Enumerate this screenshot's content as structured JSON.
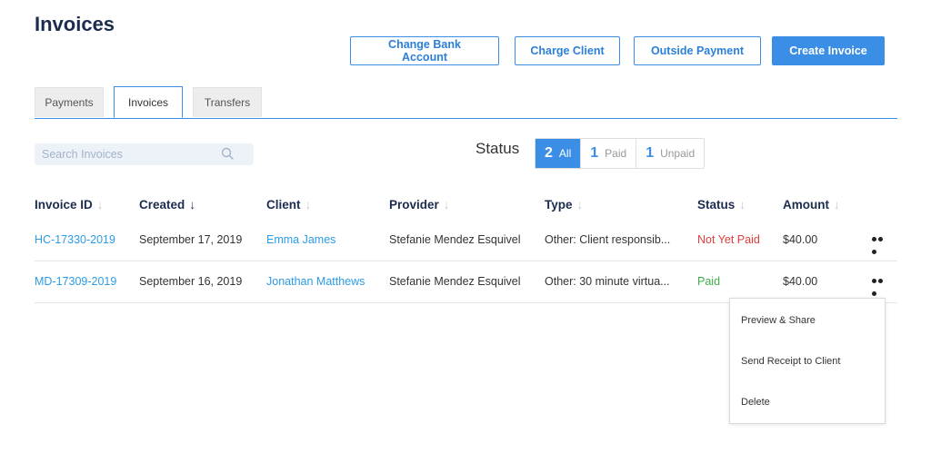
{
  "page": {
    "title": "Invoices"
  },
  "actions": {
    "change_bank": "Change Bank Account",
    "charge_client": "Charge Client",
    "outside_payment": "Outside Payment",
    "create_invoice": "Create Invoice"
  },
  "tabs": [
    {
      "label": "Payments",
      "active": false
    },
    {
      "label": "Invoices",
      "active": true
    },
    {
      "label": "Transfers",
      "active": false
    }
  ],
  "search": {
    "placeholder": "Search Invoices",
    "value": ""
  },
  "status_filter": {
    "label": "Status",
    "options": [
      {
        "count": "2",
        "label": "All",
        "active": true
      },
      {
        "count": "1",
        "label": "Paid",
        "active": false
      },
      {
        "count": "1",
        "label": "Unpaid",
        "active": false
      }
    ]
  },
  "table": {
    "columns": [
      "Invoice ID",
      "Created",
      "Client",
      "Provider",
      "Type",
      "Status",
      "Amount"
    ],
    "sort_arrow": "↓",
    "rows": [
      {
        "invoice_id": "HC-17330-2019",
        "created": "September 17, 2019",
        "client": "Emma James",
        "provider": "Stefanie Mendez Esquivel",
        "type": "Other: Client responsib...",
        "status": "Not Yet Paid",
        "amount": "$40.00"
      },
      {
        "invoice_id": "MD-17309-2019",
        "created": "September 16, 2019",
        "client": "Jonathan Matthews",
        "provider": "Stefanie Mendez Esquivel",
        "type": "Other: 30 minute virtua...",
        "status": "Paid",
        "amount": "$40.00"
      }
    ]
  },
  "row_menu": {
    "items": [
      "Preview & Share",
      "Send Receipt to Client",
      "Delete"
    ]
  },
  "colors": {
    "accent": "#3b8ee6",
    "link": "#2b9be6",
    "unpaid": "#e23c3c",
    "paid": "#3fae49",
    "heading": "#1c2c4f"
  },
  "icons": {
    "search": "search-icon",
    "more": "more-horizontal-icon",
    "sort": "sort-arrow-down-icon"
  }
}
